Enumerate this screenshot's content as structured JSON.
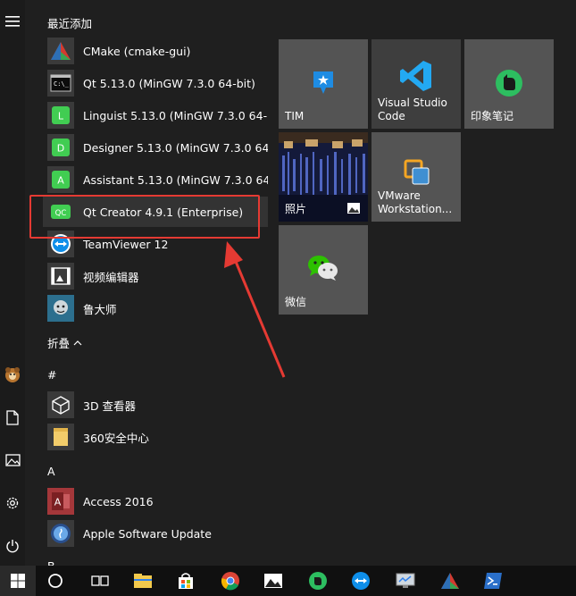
{
  "start_menu": {
    "recent_header": "最近添加",
    "collapse_label": "折叠",
    "section_hash": "#",
    "section_a": "A",
    "section_b": "B"
  },
  "recent_apps": [
    {
      "label": "CMake (cmake-gui)",
      "icon": "cmake-icon"
    },
    {
      "label": "Qt 5.13.0 (MinGW 7.3.0 64-bit)",
      "icon": "terminal-icon"
    },
    {
      "label": "Linguist 5.13.0 (MinGW 7.3.0 64-...",
      "icon": "linguist-icon"
    },
    {
      "label": "Designer 5.13.0 (MinGW 7.3.0 64...",
      "icon": "designer-icon"
    },
    {
      "label": "Assistant 5.13.0 (MinGW 7.3.0 64...",
      "icon": "assistant-icon"
    },
    {
      "label": "Qt Creator 4.9.1 (Enterprise)",
      "icon": "qtcreator-icon"
    },
    {
      "label": "TeamViewer 12",
      "icon": "teamviewer-icon"
    },
    {
      "label": "视频编辑器",
      "icon": "video-editor-icon"
    },
    {
      "label": "鲁大师",
      "icon": "ludashi-icon"
    }
  ],
  "hash_apps": [
    {
      "label": "3D 查看器",
      "icon": "3d-viewer-icon"
    },
    {
      "label": "360安全中心",
      "icon": "folder-icon"
    }
  ],
  "a_apps": [
    {
      "label": "Access 2016",
      "icon": "access-icon"
    },
    {
      "label": "Apple Software Update",
      "icon": "apple-update-icon"
    }
  ],
  "tiles": [
    {
      "label": "TIM",
      "icon": "tim-icon"
    },
    {
      "label": "Visual Studio Code",
      "icon": "vscode-icon"
    },
    {
      "label": "印象笔记",
      "icon": "evernote-icon"
    },
    {
      "label": "照片",
      "icon": "photos-icon"
    },
    {
      "label": "VMware Workstation...",
      "icon": "vmware-icon"
    },
    {
      "label": "微信",
      "icon": "wechat-icon"
    }
  ],
  "colors": {
    "annotation": "#e53a33",
    "qt_green": "#41cd52",
    "vscode_blue": "#23a9f2",
    "evernote_green": "#2dbe60",
    "wechat_green": "#2dc100",
    "access_red": "#a4373a"
  }
}
